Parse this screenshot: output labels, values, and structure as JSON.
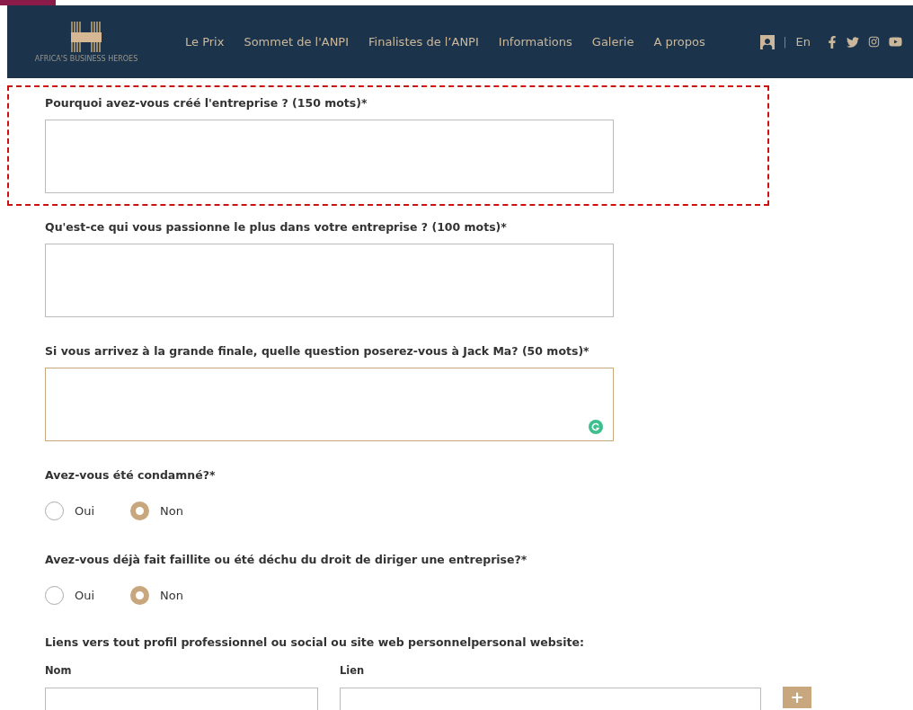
{
  "header": {
    "logo_caption": "AFRICA'S BUSINESS HEROES",
    "nav": [
      "Le Prix",
      "Sommet de l'ANPI",
      "Finalistes de l’ANPI",
      "Informations",
      "Galerie",
      "A propos"
    ],
    "language": "En",
    "separator": "|"
  },
  "questions": [
    {
      "kind": "textarea",
      "label": "Pourquoi avez-vous créé l'entreprise ? (150 mots)*",
      "highlighted": true,
      "focused": false
    },
    {
      "kind": "textarea",
      "label": "Qu'est-ce qui vous passionne le plus dans votre entreprise ? (100 mots)*",
      "highlighted": false,
      "focused": false
    },
    {
      "kind": "textarea",
      "label": "Si vous arrivez à la grande finale, quelle question poserez-vous à Jack Ma? (50 mots)*",
      "highlighted": false,
      "focused": true
    },
    {
      "kind": "radio",
      "label": "Avez-vous été condamné?*",
      "highlighted": false,
      "options": [
        {
          "label": "Oui",
          "selected": false
        },
        {
          "label": "Non",
          "selected": true
        }
      ]
    },
    {
      "kind": "radio",
      "label": "Avez-vous déjà fait faillite ou été déchu du droit de diriger une entreprise?*",
      "highlighted": false,
      "options": [
        {
          "label": "Oui",
          "selected": false
        },
        {
          "label": "Non",
          "selected": true
        }
      ]
    }
  ],
  "links": {
    "label": "Liens vers tout profil professionnel ou social ou site web personnelpersonal website:",
    "columns": [
      "Nom",
      "Lien"
    ],
    "add_button": "+"
  }
}
